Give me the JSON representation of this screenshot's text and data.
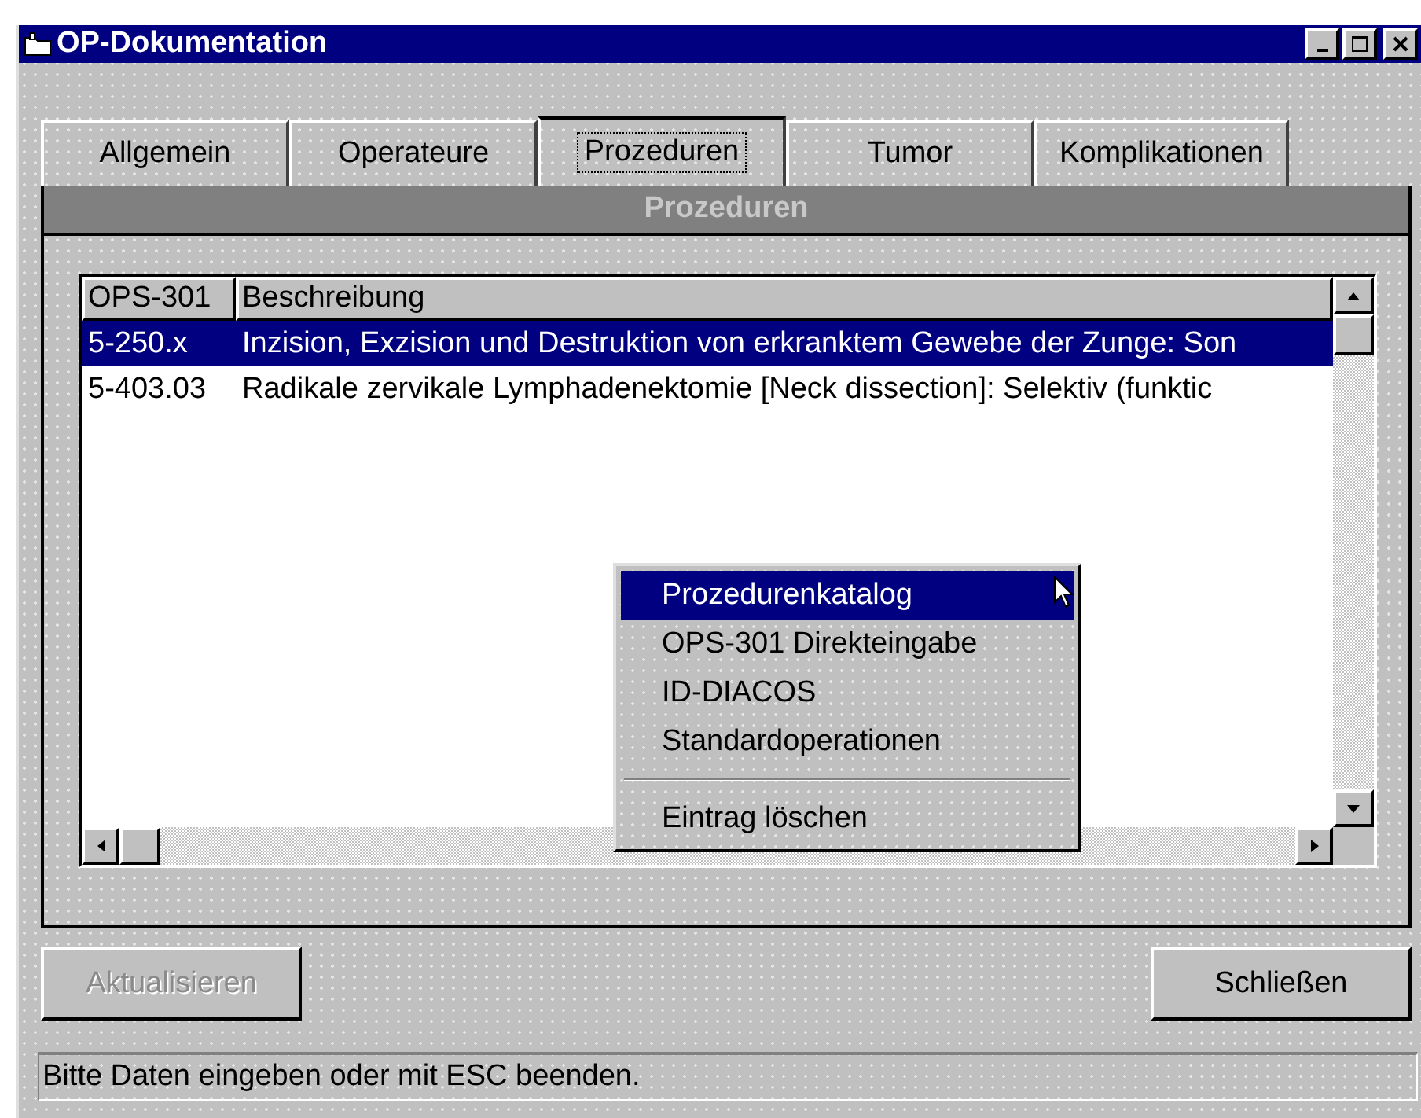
{
  "window": {
    "title": "OP-Dokumentation"
  },
  "tabs": [
    {
      "label": "Allgemein",
      "selected": false
    },
    {
      "label": "Operateure",
      "selected": false
    },
    {
      "label": "Prozeduren",
      "selected": true
    },
    {
      "label": "Tumor",
      "selected": false
    },
    {
      "label": "Komplikationen",
      "selected": false
    }
  ],
  "panel": {
    "title": "Prozeduren"
  },
  "table": {
    "columns": [
      "OPS-301",
      "Beschreibung"
    ],
    "rows": [
      {
        "cells": [
          "5-250.x",
          "Inzision, Exzision und Destruktion von erkranktem Gewebe der Zunge: Son"
        ],
        "selected": true
      },
      {
        "cells": [
          "5-403.03",
          "Radikale zervikale Lymphadenektomie [Neck dissection]: Selektiv (funktic"
        ],
        "selected": false
      }
    ]
  },
  "context_menu": {
    "items": [
      {
        "kind": "item",
        "label": "Prozedurenkatalog",
        "selected": true
      },
      {
        "kind": "item",
        "label": "OPS-301 Direkteingabe",
        "selected": false
      },
      {
        "kind": "item",
        "label": "ID-DIACOS",
        "selected": false
      },
      {
        "kind": "item",
        "label": "Standardoperationen",
        "selected": false
      },
      {
        "kind": "separator"
      },
      {
        "kind": "item",
        "label": "Eintrag löschen",
        "selected": false
      }
    ]
  },
  "buttons": [
    {
      "label": "Aktualisieren",
      "disabled": true
    },
    {
      "label": "Schließen",
      "disabled": false
    }
  ],
  "status_bar": "Bitte Daten eingeben oder mit ESC beenden."
}
